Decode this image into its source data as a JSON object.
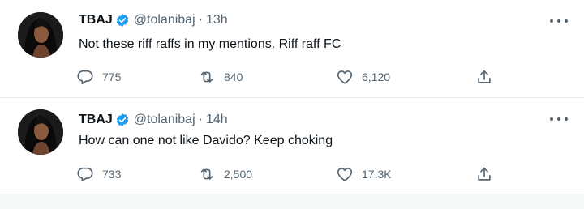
{
  "tweets": [
    {
      "name": "TBAJ",
      "handle": "@tolanibaj",
      "separator": "·",
      "time": "13h",
      "text": "Not these riff raffs in my mentions. Riff raff FC",
      "replies": "775",
      "retweets": "840",
      "likes": "6,120"
    },
    {
      "name": "TBAJ",
      "handle": "@tolanibaj",
      "separator": "·",
      "time": "14h",
      "text": "How can one not like Davido? Keep choking",
      "replies": "733",
      "retweets": "2,500",
      "likes": "17.3K"
    }
  ],
  "icons": {
    "verified": "verified-badge-icon",
    "more": "more-dots-icon",
    "reply": "reply-bubble-icon",
    "retweet": "retweet-arrows-icon",
    "like": "heart-icon",
    "share": "share-upload-icon"
  },
  "colors": {
    "verified": "#1d9bf0",
    "text": "#0f1419",
    "muted": "#536471",
    "divider": "#e6ecf0"
  }
}
